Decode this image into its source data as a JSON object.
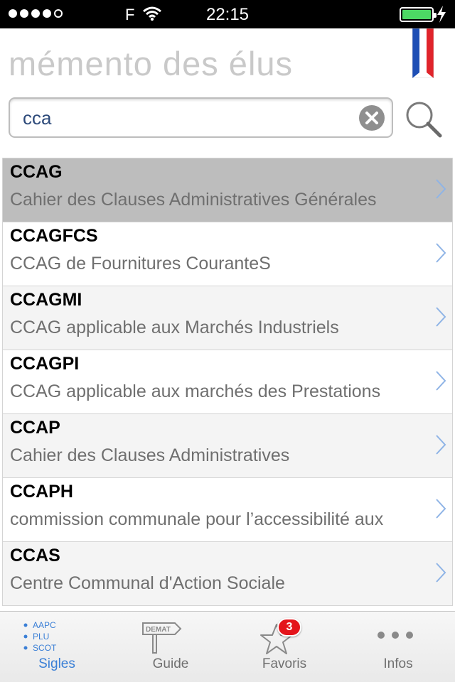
{
  "status_bar": {
    "carrier": "F",
    "time": "22:15",
    "signal_bars": 4,
    "signal_total": 5,
    "battery_level": 1.0
  },
  "header": {
    "title": "mémento des élus",
    "flag_colors": [
      "#1f4fb5",
      "#ffffff",
      "#e0242b"
    ]
  },
  "search": {
    "value": "cca",
    "placeholder": ""
  },
  "results": [
    {
      "acronym": "CCAG",
      "description": "Cahier des Clauses Administratives Générales",
      "selected": true
    },
    {
      "acronym": "CCAGFCS",
      "description": "CCAG de Fournitures CouranteS",
      "selected": false
    },
    {
      "acronym": "CCAGMI",
      "description": "CCAG applicable aux Marchés Industriels",
      "selected": false
    },
    {
      "acronym": "CCAGPI",
      "description": "CCAG applicable aux marchés des Prestations",
      "selected": false
    },
    {
      "acronym": "CCAP",
      "description": "Cahier des Clauses Administratives",
      "selected": false
    },
    {
      "acronym": "CCAPH",
      "description": "commission communale pour l’accessibilité aux",
      "selected": false
    },
    {
      "acronym": "CCAS",
      "description": "Centre Communal d'Action Sociale",
      "selected": false
    }
  ],
  "tabs": [
    {
      "label": "Sigles",
      "icon": "acronyms-list-icon",
      "icon_text": [
        "AAPC",
        "PLU",
        "SCOT"
      ],
      "active": true
    },
    {
      "label": "Guide",
      "icon": "signpost-icon",
      "icon_text": [
        "DEMAT"
      ],
      "active": false
    },
    {
      "label": "Favoris",
      "icon": "star-icon",
      "badge": "3",
      "active": false
    },
    {
      "label": "Infos",
      "icon": "more-dots-icon",
      "active": false
    }
  ],
  "colors": {
    "accent": "#3a7fd6",
    "badge": "#e4141b",
    "battery": "#4cd964",
    "chevron": "#8fb4e6"
  }
}
